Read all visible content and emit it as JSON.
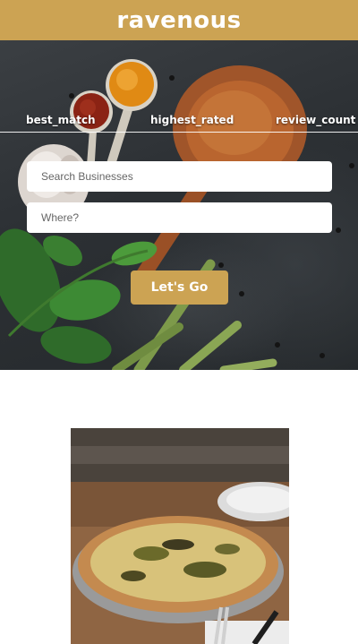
{
  "header": {
    "brand": "ravenous"
  },
  "sort_options": [
    "best_match",
    "highest_rated",
    "review_count"
  ],
  "search": {
    "business_placeholder": "Search Businesses",
    "location_placeholder": "Where?",
    "submit_label": "Let's Go"
  },
  "colors": {
    "brand": "#cca353",
    "hero_bg": "#2c3034",
    "text_light": "#ffffff"
  },
  "icons": [
    "hero-food-photo",
    "pizza-photo"
  ]
}
